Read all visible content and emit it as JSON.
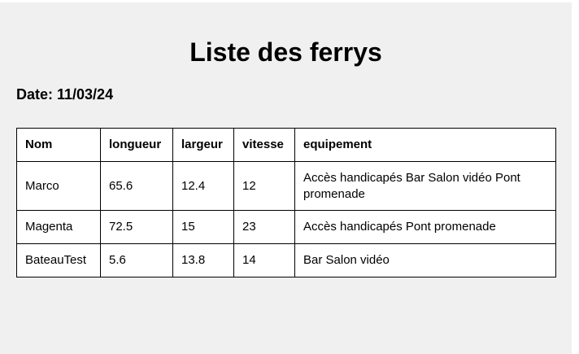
{
  "title": "Liste des ferrys",
  "date_label": "Date: 11/03/24",
  "table": {
    "headers": [
      "Nom",
      "longueur",
      "largeur",
      "vitesse",
      "equipement"
    ],
    "rows": [
      [
        "Marco",
        "65.6",
        "12.4",
        "12",
        "Accès handicapés Bar Salon vidéo Pont promenade"
      ],
      [
        "Magenta",
        "72.5",
        "15",
        "23",
        "Accès handicapés Pont promenade"
      ],
      [
        "BateauTest",
        "5.6",
        "13.8",
        "14",
        "Bar Salon vidéo"
      ]
    ]
  }
}
